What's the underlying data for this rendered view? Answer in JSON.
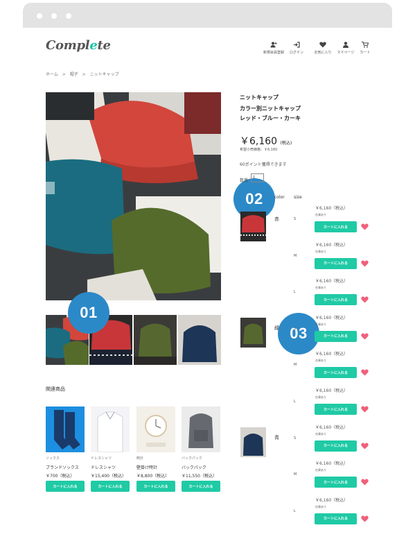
{
  "header": {
    "logo_text": "Compl",
    "logo_accent": "e",
    "logo_end": "te",
    "nav": [
      {
        "label": "新規会員登録",
        "icon": "user-plus-icon"
      },
      {
        "label": "ログイン",
        "icon": "login-icon"
      },
      {
        "label": "お気に入り",
        "icon": "heart-icon"
      },
      {
        "label": "マイページ",
        "icon": "user-icon"
      },
      {
        "label": "カート",
        "icon": "cart-icon"
      }
    ]
  },
  "breadcrumb": [
    "ホーム",
    ">",
    "帽子",
    ">",
    "ニットキャップ"
  ],
  "badges": {
    "b1": "01",
    "b2": "02",
    "b3": "03"
  },
  "product": {
    "category": "ニットキャップ",
    "name": "カラー別ニットキャップ",
    "colors_line": "レッド・ブルー・カーキ",
    "price": "￥6,160",
    "tax": "(税込)",
    "retail": "希望小売価格：￥6,160",
    "points": "60ポイント獲得できます",
    "qty_label": "数量",
    "qty_value": "1"
  },
  "variant_headers": {
    "color": "color",
    "size": "size"
  },
  "colors": [
    {
      "name": "赤"
    },
    {
      "name": "緑"
    },
    {
      "name": "青"
    }
  ],
  "variants": [
    {
      "size": "S",
      "price": "￥6,160（税込）",
      "stock": "在庫あり",
      "button": "カートに入れる"
    },
    {
      "size": "M",
      "price": "￥6,160（税込）",
      "stock": "在庫あり",
      "button": "カートに入れる"
    },
    {
      "size": "L",
      "price": "￥6,160（税込）",
      "stock": "在庫あり",
      "button": "カートに入れる"
    },
    {
      "size": "S",
      "price": "￥6,160（税込）",
      "stock": "在庫あり",
      "button": "カートに入れる"
    },
    {
      "size": "M",
      "price": "￥6,160（税込）",
      "stock": "在庫あり",
      "button": "カートに入れる"
    },
    {
      "size": "L",
      "price": "￥6,160（税込）",
      "stock": "在庫あり",
      "button": "カートに入れる"
    },
    {
      "size": "S",
      "price": "￥6,160（税込）",
      "stock": "在庫あり",
      "button": "カートに入れる"
    },
    {
      "size": "M",
      "price": "￥6,160（税込）",
      "stock": "在庫あり",
      "button": "カートに入れる"
    },
    {
      "size": "L",
      "price": "￥6,160（税込）",
      "stock": "在庫あり",
      "button": "カートに入れる"
    }
  ],
  "related": {
    "title": "関連商品",
    "items": [
      {
        "category": "ソックス",
        "name": "ブランドソックス",
        "price": "￥700（税込）",
        "button": "カートに入れる"
      },
      {
        "category": "ドレスシャツ",
        "name": "ドレスシャツ",
        "price": "￥15,400（税込）",
        "button": "カートに入れる"
      },
      {
        "category": "時計",
        "name": "壁掛け時計",
        "price": "￥8,800（税込）",
        "button": "カートに入れる"
      },
      {
        "category": "バックパック",
        "name": "バックパック",
        "price": "￥11,550（税込）",
        "button": "カートに入れる"
      }
    ]
  },
  "colors_theme": {
    "accent": "#1fcaa5",
    "badge": "#2c89c7",
    "heart": "#f0607a"
  }
}
